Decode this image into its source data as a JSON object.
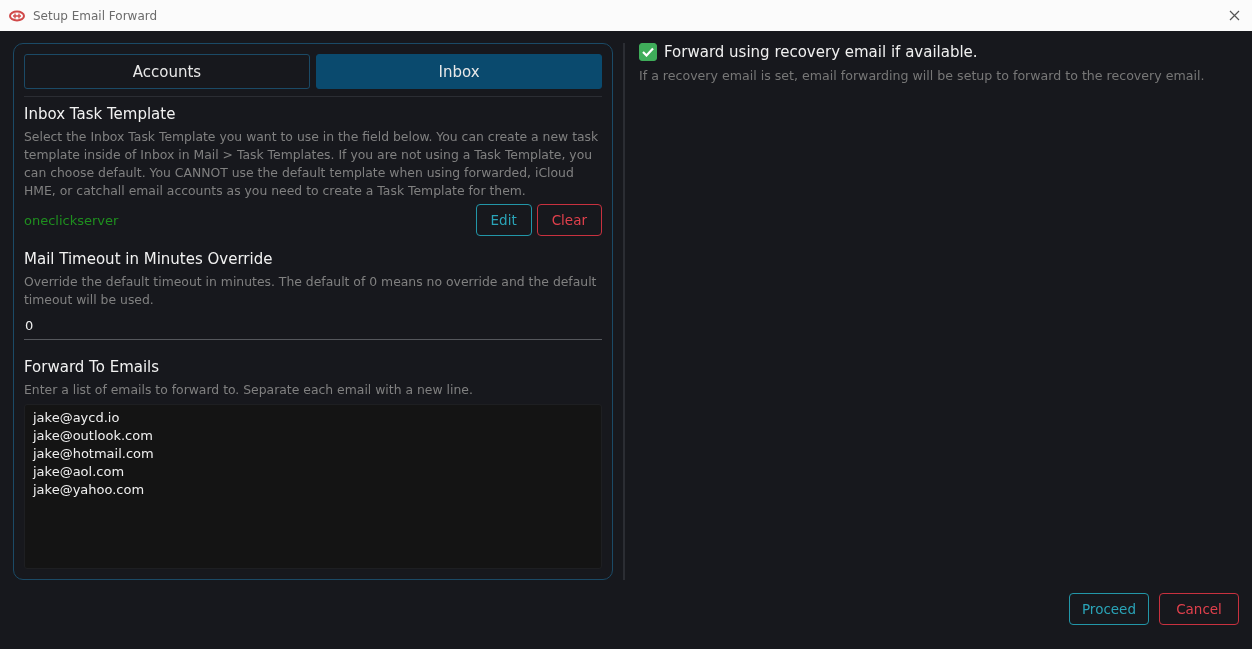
{
  "window": {
    "title": "Setup Email Forward"
  },
  "tabs": [
    {
      "label": "Accounts",
      "selected": false
    },
    {
      "label": "Inbox",
      "selected": true
    }
  ],
  "template_section": {
    "title": "Inbox Task Template",
    "description": "Select the Inbox Task Template you want to use in the field below. You can create a new task template inside of Inbox in Mail > Task Templates. If you are not using a Task Template, you can choose default. You CANNOT use the default template when using forwarded, iCloud HME, or catchall email accounts as you need to create a Task Template for them.",
    "value": "oneclickserver",
    "buttons": [
      {
        "label": "Edit",
        "kind": "primary"
      },
      {
        "label": "Clear",
        "kind": "danger"
      }
    ]
  },
  "timeout_section": {
    "title": "Mail Timeout in Minutes Override",
    "description": "Override the default timeout in minutes. The default of 0 means no override and the default timeout will be used.",
    "value": "0"
  },
  "emails_section": {
    "title": "Forward To Emails",
    "description": "Enter a list of emails to forward to. Separate each email with a new line.",
    "lines": [
      "jake@aycd.io",
      "jake@outlook.com",
      "jake@hotmail.com",
      "jake@aol.com",
      "jake@yahoo.com"
    ]
  },
  "recovery_option": {
    "label": "Forward using recovery email if available.",
    "checked": true,
    "description": "If a recovery email is set, email forwarding will be setup to forward to the recovery email."
  },
  "footer_buttons": [
    {
      "label": "Proceed",
      "kind": "primary"
    },
    {
      "label": "Cancel",
      "kind": "danger"
    }
  ]
}
